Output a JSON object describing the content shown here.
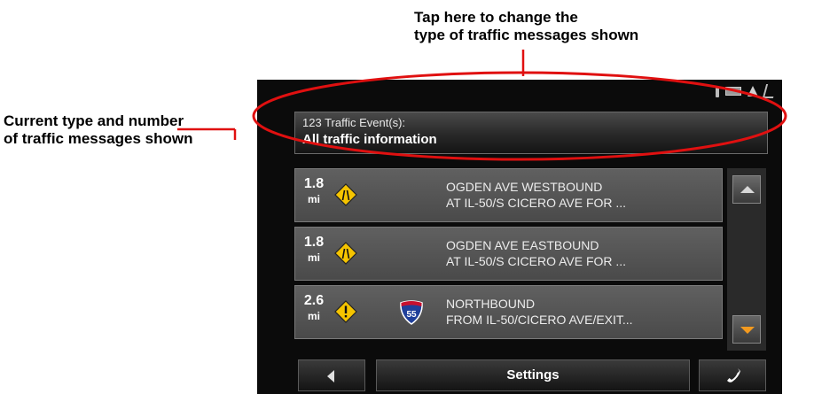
{
  "annotations": {
    "top_line1": "Tap here to change the",
    "top_line2": "type of traffic messages shown",
    "left_line1": "Current type and number",
    "left_line2": "of traffic messages shown"
  },
  "header": {
    "count": "123 Traffic Event(s):",
    "type": "All traffic information"
  },
  "events": [
    {
      "distance": "1.8",
      "unit": "mi",
      "icon": "lane-narrows-warning-icon",
      "shield": "",
      "line1": "OGDEN AVE WESTBOUND",
      "line2": "AT IL-50/S CICERO AVE FOR ..."
    },
    {
      "distance": "1.8",
      "unit": "mi",
      "icon": "lane-narrows-warning-icon",
      "shield": "",
      "line1": "OGDEN AVE EASTBOUND",
      "line2": "AT IL-50/S CICERO AVE FOR ..."
    },
    {
      "distance": "2.6",
      "unit": "mi",
      "icon": "warning-icon",
      "shield": "55",
      "line1": "NORTHBOUND",
      "line2": "FROM IL-50/CICERO AVE/EXIT..."
    }
  ],
  "bottom_bar": {
    "settings_label": "Settings"
  },
  "icons": {
    "status": [
      "phone-icon",
      "battery-icon",
      "signal-icon",
      "gps-icon"
    ],
    "scroll_up": "scroll-up-arrow-icon",
    "scroll_down": "scroll-down-arrow-icon",
    "back": "back-arrow-icon",
    "phone": "phone-handset-icon"
  },
  "colors": {
    "annotation_red": "#e01010",
    "warning_yellow": "#f5c400",
    "shield_blue": "#1f3f9a",
    "shield_red": "#c8102e",
    "scroll_down_orange": "#f39a1f"
  }
}
